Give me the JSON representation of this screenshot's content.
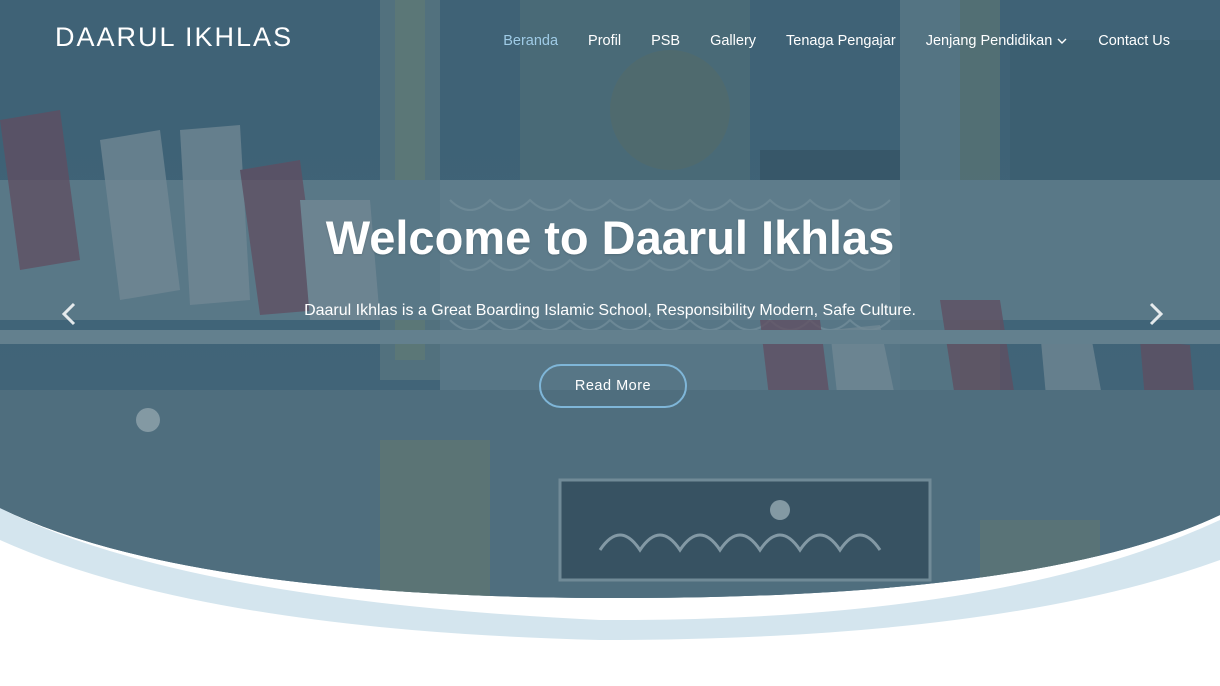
{
  "brand": {
    "name": "DAARUL IKHLAS"
  },
  "nav": {
    "items": [
      {
        "label": "Beranda",
        "active": true
      },
      {
        "label": "Profil"
      },
      {
        "label": "PSB"
      },
      {
        "label": "Gallery"
      },
      {
        "label": "Tenaga Pengajar"
      },
      {
        "label": "Jenjang Pendidikan",
        "has_dropdown": true,
        "icon": "chevron-down-icon"
      },
      {
        "label": "Contact Us"
      }
    ]
  },
  "hero": {
    "title": "Welcome to Daarul Ikhlas",
    "subtitle": "Daarul Ikhlas is a Great Boarding Islamic School, Responsibility Modern, Safe Culture.",
    "button_label": "Read More",
    "prev_icon": "chevron-left-icon",
    "next_icon": "chevron-right-icon",
    "background": "photo of the Daarul Ikhlas pesantren building facade with blue overlay"
  },
  "colors": {
    "overlay": "#3c6378",
    "accent": "#9fcbe6",
    "button_border": "#7fb6d8",
    "wave": "#d4e5ee",
    "text": "#ffffff"
  }
}
